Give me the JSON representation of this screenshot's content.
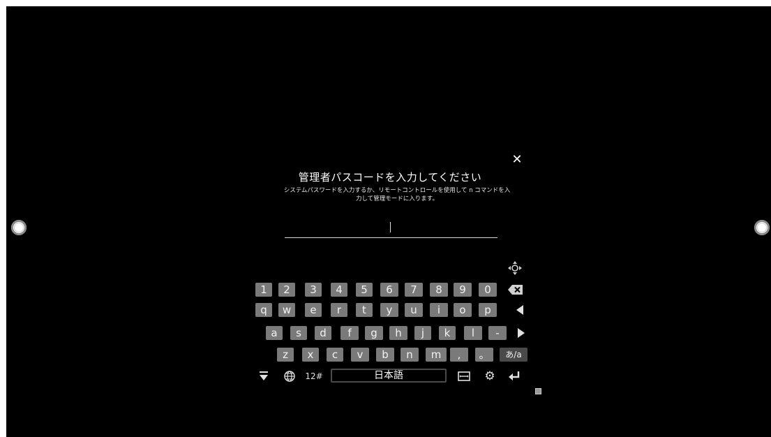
{
  "dialog": {
    "title": "管理者パスコードを入力してください",
    "description": "システムパスワードを入力するか、リモートコントロールを使用して n コマンドを入力して管理モードに入ります。",
    "close_icon": "close-icon",
    "password_value": ""
  },
  "keyboard": {
    "row1": [
      "1",
      "2",
      "3",
      "4",
      "5",
      "6",
      "7",
      "8",
      "9",
      "0"
    ],
    "row2": [
      "q",
      "w",
      "e",
      "r",
      "t",
      "y",
      "u",
      "i",
      "o",
      "p"
    ],
    "row3": [
      "a",
      "s",
      "d",
      "f",
      "g",
      "h",
      "j",
      "k",
      "l",
      "-"
    ],
    "row4": [
      "z",
      "x",
      "c",
      "v",
      "b",
      "n",
      "m",
      ",",
      "。"
    ],
    "kana_toggle": "あ/a",
    "symbols_label": "12#",
    "space_label": "日本語",
    "icons": {
      "backspace": "backspace-icon",
      "left": "arrow-left-icon",
      "right": "arrow-right-icon",
      "hide": "hide-keyboard-icon",
      "globe": "globe-icon",
      "cursor": "cursor-mode-icon",
      "settings": "gear-icon",
      "enter": "enter-icon",
      "move": "move-icon",
      "resize": "resize-icon"
    }
  },
  "colors": {
    "background": "#000000",
    "key": "#7a7a7a",
    "key_dark": "#4a4a4a",
    "text": "#ffffff"
  }
}
